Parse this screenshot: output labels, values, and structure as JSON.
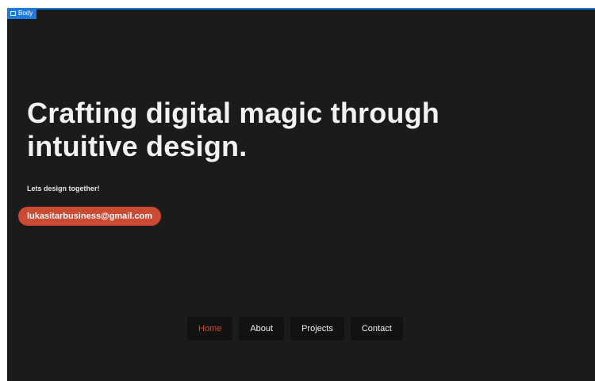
{
  "editor": {
    "selection_label": "Body"
  },
  "hero": {
    "headline": "Crafting digital magic through intuitive design.",
    "subtitle": "Lets design together!",
    "email": "lukasitarbusiness@gmail.com"
  },
  "nav": {
    "items": [
      {
        "label": "Home",
        "active": true
      },
      {
        "label": "About",
        "active": false
      },
      {
        "label": "Projects",
        "active": false
      },
      {
        "label": "Contact",
        "active": false
      }
    ]
  },
  "colors": {
    "background": "#1b1b1b",
    "accent": "#cc4a34",
    "nav_bg": "#121212",
    "selection": "#1f7ae0"
  }
}
